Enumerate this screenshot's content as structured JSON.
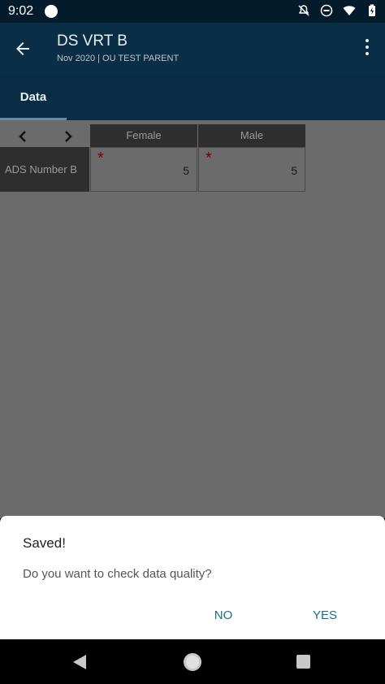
{
  "status_bar": {
    "time": "9:02",
    "icons": [
      "app-icon",
      "notifications-off-icon",
      "do-not-disturb-icon",
      "wifi-icon",
      "battery-charging-icon"
    ]
  },
  "app_bar": {
    "title": "DS VRT B",
    "subtitle": "Nov 2020 | OU TEST PARENT"
  },
  "tabs": [
    {
      "label": "Data",
      "active": true
    }
  ],
  "table": {
    "columns": [
      "Female",
      "Male"
    ],
    "rows": [
      {
        "label": "ADS Number B",
        "cells": [
          {
            "value": "5",
            "required": true
          },
          {
            "value": "5",
            "required": true
          }
        ]
      }
    ],
    "required_marker": "*"
  },
  "dialog": {
    "title": "Saved!",
    "message": "Do you want to check data quality?",
    "no_label": "NO",
    "yes_label": "YES"
  },
  "colors": {
    "app_bar": "#0b2e47",
    "accent_button": "#1b6c8f",
    "required_marker": "#7a0000"
  }
}
